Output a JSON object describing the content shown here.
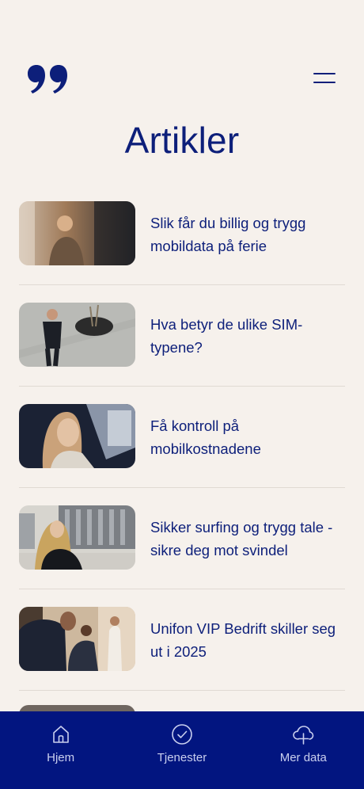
{
  "header": {
    "logo_icon": "quote-logo-icon",
    "menu_icon": "hamburger-menu-icon"
  },
  "page_title": "Artikler",
  "articles": [
    {
      "title": "Slik får du billig og trygg mobildata på ferie",
      "image": "woman-on-phone-photo"
    },
    {
      "title": "Hva betyr de ulike SIM-typene?",
      "image": "man-with-phone-in-plaza-photo"
    },
    {
      "title": "Få kontroll på mobilkostnadene",
      "image": "woman-in-car-photo"
    },
    {
      "title": "Sikker surfing og trygg tale - sikre deg mot svindel",
      "image": "woman-in-city-photo"
    },
    {
      "title": "Unifon VIP Bedrift skiller seg ut i 2025",
      "image": "business-people-meeting-photo"
    }
  ],
  "bottom_nav": {
    "items": [
      {
        "label": "Hjem",
        "icon": "home-icon"
      },
      {
        "label": "Tjenester",
        "icon": "check-circle-icon"
      },
      {
        "label": "Mer data",
        "icon": "cloud-plus-icon"
      }
    ]
  },
  "colors": {
    "background": "#f6f1ec",
    "primary": "#0d1f7a",
    "nav_background": "#021580"
  }
}
